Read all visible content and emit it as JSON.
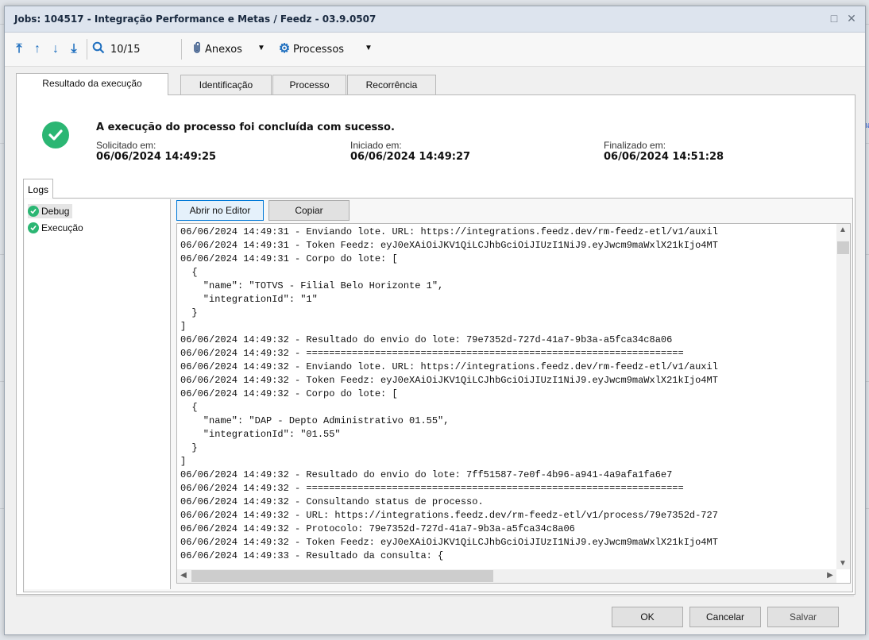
{
  "window": {
    "title": "Jobs: 104517 - Integração Performance e Metas / Feedz - 03.9.0507"
  },
  "toolbar": {
    "counter": "10/15",
    "attachments_label": "Anexos",
    "processes_label": "Processos"
  },
  "tabs": [
    {
      "label": "Resultado da execução",
      "active": true
    },
    {
      "label": "Identificação",
      "active": false
    },
    {
      "label": "Processo",
      "active": false
    },
    {
      "label": "Recorrência",
      "active": false
    }
  ],
  "result": {
    "message": "A execução do processo foi concluída com sucesso.",
    "requested_label": "Solicitado em:",
    "requested_value": "06/06/2024 14:49:25",
    "started_label": "Iniciado em:",
    "started_value": "06/06/2024 14:49:27",
    "finished_label": "Finalizado em:",
    "finished_value": "06/06/2024 14:51:28"
  },
  "logs": {
    "tab_label": "Logs",
    "tree": [
      {
        "label": "Debug",
        "selected": true
      },
      {
        "label": "Execução",
        "selected": false
      }
    ],
    "open_editor_label": "Abrir no Editor",
    "copy_label": "Copiar",
    "content": "06/06/2024 14:49:31 - Enviando lote. URL: https://integrations.feedz.dev/rm-feedz-etl/v1/auxil\n06/06/2024 14:49:31 - Token Feedz: eyJ0eXAiOiJKV1QiLCJhbGciOiJIUzI1NiJ9.eyJwcm9maWxlX21kIjo4MT\n06/06/2024 14:49:31 - Corpo do lote: [\n  {\n    \"name\": \"TOTVS - Filial Belo Horizonte 1\",\n    \"integrationId\": \"1\"\n  }\n]\n06/06/2024 14:49:32 - Resultado do envio do lote: 79e7352d-727d-41a7-9b3a-a5fca34c8a06\n06/06/2024 14:49:32 - ==================================================================\n06/06/2024 14:49:32 - Enviando lote. URL: https://integrations.feedz.dev/rm-feedz-etl/v1/auxil\n06/06/2024 14:49:32 - Token Feedz: eyJ0eXAiOiJKV1QiLCJhbGciOiJIUzI1NiJ9.eyJwcm9maWxlX21kIjo4MT\n06/06/2024 14:49:32 - Corpo do lote: [\n  {\n    \"name\": \"DAP - Depto Administrativo 01.55\",\n    \"integrationId\": \"01.55\"\n  }\n]\n06/06/2024 14:49:32 - Resultado do envio do lote: 7ff51587-7e0f-4b96-a941-4a9afa1fa6e7\n06/06/2024 14:49:32 - ==================================================================\n06/06/2024 14:49:32 - Consultando status de processo.\n06/06/2024 14:49:32 - URL: https://integrations.feedz.dev/rm-feedz-etl/v1/process/79e7352d-727\n06/06/2024 14:49:32 - Protocolo: 79e7352d-727d-41a7-9b3a-a5fca34c8a06\n06/06/2024 14:49:32 - Token Feedz: eyJ0eXAiOiJKV1QiLCJhbGciOiJIUzI1NiJ9.eyJwcm9maWxlX21kIjo4MT\n06/06/2024 14:49:33 - Resultado da consulta: {"
  },
  "footer": {
    "ok_label": "OK",
    "cancel_label": "Cancelar",
    "save_label": "Salvar"
  },
  "background": {
    "right_edge_text": "na"
  }
}
